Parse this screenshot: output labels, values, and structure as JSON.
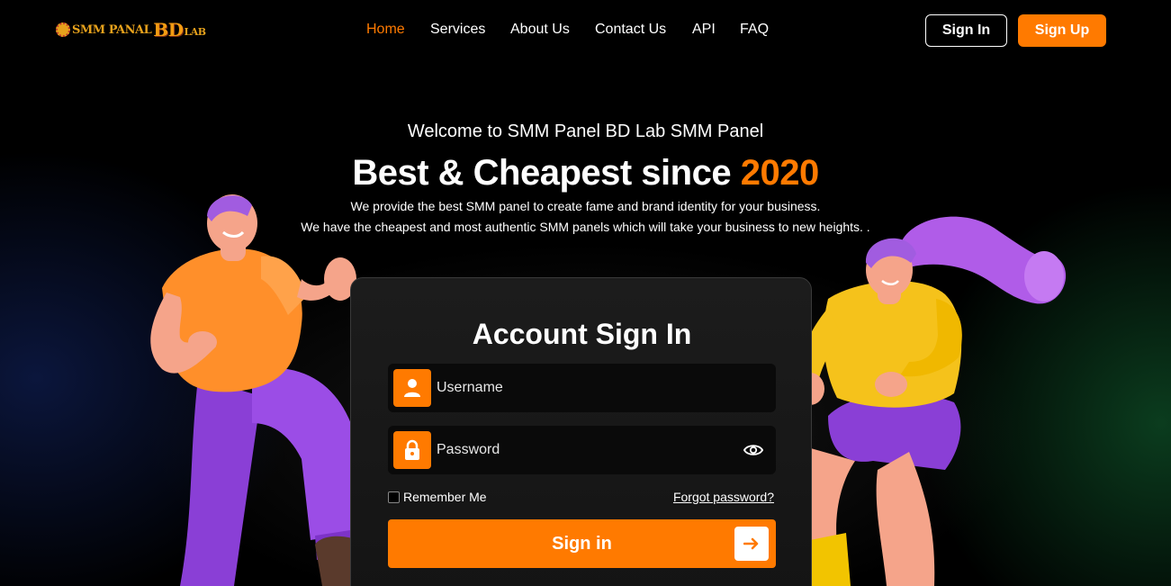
{
  "brand": {
    "logo_part1": "SMM PANAL",
    "logo_part2": "BD",
    "logo_part3": "LAB",
    "accent_color": "#ff7a00"
  },
  "nav": {
    "items": [
      {
        "label": "Home",
        "active": true
      },
      {
        "label": "Services",
        "active": false
      },
      {
        "label": "About Us",
        "active": false
      },
      {
        "label": "Contact Us",
        "active": false
      },
      {
        "label": "API",
        "active": false
      },
      {
        "label": "FAQ",
        "active": false
      }
    ],
    "signin_label": "Sign In",
    "signup_label": "Sign Up"
  },
  "hero": {
    "welcome": "Welcome to SMM Panel BD Lab SMM Panel",
    "headline": "Best & Cheapest since ",
    "headline_accent": "2020",
    "sub1": "We provide the best SMM panel to create fame and brand identity for your business.",
    "sub2": "We have the cheapest and most authentic SMM panels which will take your business to new heights. ."
  },
  "form": {
    "title": "Account Sign In",
    "username_placeholder": "Username",
    "password_placeholder": "Password",
    "remember_label": "Remember Me",
    "forgot_label": "Forgot password?",
    "submit_label": "Sign in"
  },
  "icons": {
    "user": "user-icon",
    "lock": "lock-icon",
    "eye": "eye-icon",
    "arrow": "arrow-right-icon"
  }
}
